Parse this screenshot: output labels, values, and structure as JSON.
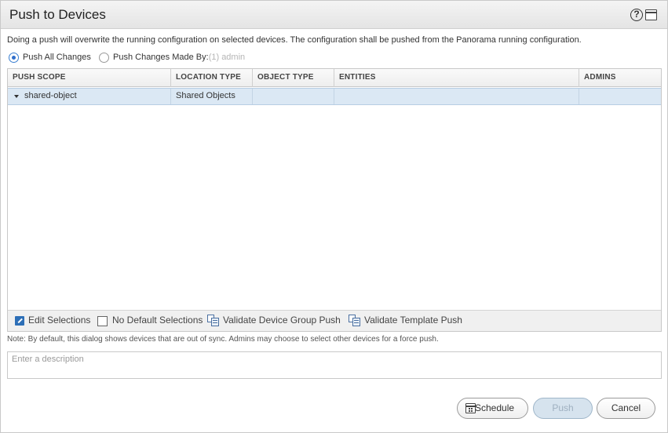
{
  "dialog": {
    "title": "Push to Devices",
    "help_icon": "help-icon",
    "window_icon": "maximize-icon",
    "info_text": "Doing a push will overwrite the running configuration on selected devices. The configuration shall be pushed from the Panorama running configuration."
  },
  "options": {
    "push_all_label": "Push All Changes",
    "push_all_selected": true,
    "push_by_label": "Push Changes Made By:",
    "push_by_admin": "(1) admin"
  },
  "table": {
    "columns": [
      "PUSH SCOPE",
      "LOCATION TYPE",
      "OBJECT TYPE",
      "ENTITIES",
      "ADMINS"
    ],
    "rows": [
      {
        "push_scope": "shared-object",
        "location_type": "Shared Objects",
        "object_type": "",
        "entities": "",
        "admins": ""
      }
    ]
  },
  "footer": {
    "edit_selections": "Edit Selections",
    "no_default_selections": "No Default Selections",
    "no_default_checked": false,
    "validate_dg": "Validate Device Group Push",
    "validate_template": "Validate Template Push"
  },
  "note": "Note: By default, this dialog shows devices that are out of sync. Admins may choose to select other devices for a force push.",
  "description": {
    "placeholder": "Enter a description",
    "value": ""
  },
  "buttons": {
    "schedule": "Schedule",
    "push": "Push",
    "cancel": "Cancel"
  },
  "colors": {
    "selected_row": "#dbe8f4",
    "accent": "#2f6fcc",
    "push_disabled_bg": "#d6e3ee"
  }
}
